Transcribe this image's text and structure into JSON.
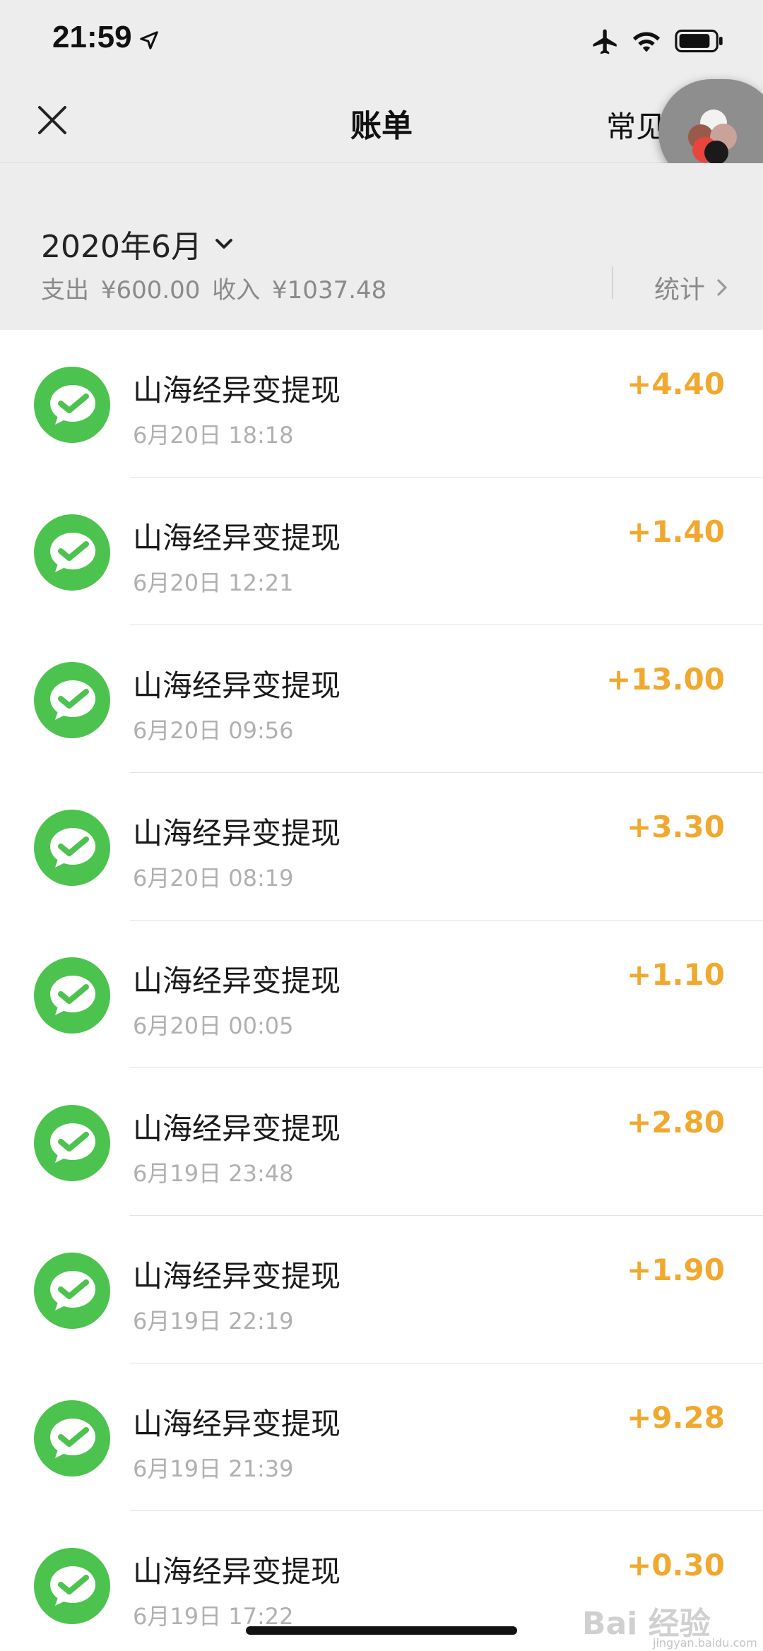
{
  "status_bar": {
    "time": "21:59"
  },
  "nav": {
    "title": "账单",
    "faq_label": "常见"
  },
  "summary": {
    "month": "2020年6月",
    "expense_label": "支出",
    "expense_value": "¥600.00",
    "income_label": "收入",
    "income_value": "¥1037.48",
    "stats_label": "统计"
  },
  "transactions": [
    {
      "title": "山海经异变提现",
      "time": "6月20日 18:18",
      "amount": "+4.40"
    },
    {
      "title": "山海经异变提现",
      "time": "6月20日 12:21",
      "amount": "+1.40"
    },
    {
      "title": "山海经异变提现",
      "time": "6月20日 09:56",
      "amount": "+13.00"
    },
    {
      "title": "山海经异变提现",
      "time": "6月20日 08:19",
      "amount": "+3.30"
    },
    {
      "title": "山海经异变提现",
      "time": "6月20日 00:05",
      "amount": "+1.10"
    },
    {
      "title": "山海经异变提现",
      "time": "6月19日 23:48",
      "amount": "+2.80"
    },
    {
      "title": "山海经异变提现",
      "time": "6月19日 22:19",
      "amount": "+1.90"
    },
    {
      "title": "山海经异变提现",
      "time": "6月19日 21:39",
      "amount": "+9.28"
    },
    {
      "title": "山海经异变提现",
      "time": "6月19日 17:22",
      "amount": "+0.30"
    }
  ],
  "icons": {
    "transaction_icon": "wechat-pay-icon",
    "close": "close-icon",
    "month_dropdown": "chevron-down-icon",
    "stats_arrow": "chevron-right-icon"
  },
  "colors": {
    "accent_amount": "#f0a92e",
    "icon_green": "#4cc34e",
    "header_bg": "#ededed"
  },
  "watermark": {
    "text": "Bai 经验",
    "sub": "jingyan.baidu.com"
  }
}
